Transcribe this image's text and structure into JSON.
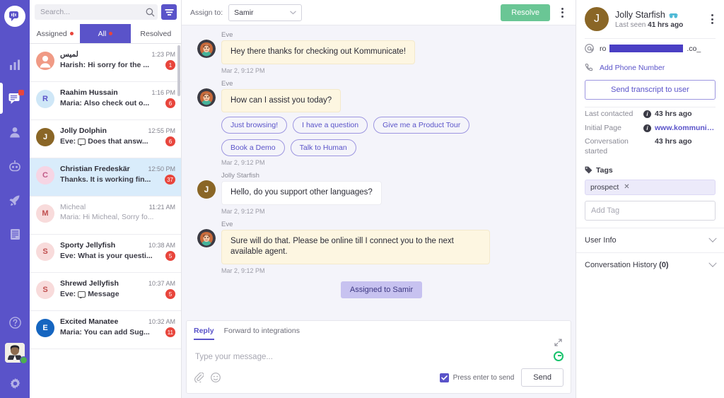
{
  "rail": {
    "logo_icon": "kommunicate-logo-icon",
    "items": [
      {
        "icon": "bar-chart-icon",
        "name": "dashboard"
      },
      {
        "icon": "chat-icon",
        "name": "conversations",
        "active": true,
        "badge": true
      },
      {
        "icon": "people-icon",
        "name": "users"
      },
      {
        "icon": "bot-icon",
        "name": "bots"
      },
      {
        "icon": "rocket-icon",
        "name": "integrations"
      },
      {
        "icon": "book-icon",
        "name": "knowledge-base"
      }
    ],
    "bottom": [
      {
        "icon": "help-icon",
        "name": "help"
      },
      {
        "icon": "avatar",
        "name": "account",
        "status": "online"
      },
      {
        "icon": "gear-icon",
        "name": "settings"
      }
    ]
  },
  "search": {
    "placeholder": "Search...",
    "value": "",
    "filter_icon": "filter-icon",
    "search_icon": "search-icon"
  },
  "tabs": [
    {
      "label": "Assigned",
      "dot": true,
      "active": false
    },
    {
      "label": "All",
      "dot": true,
      "active": true
    },
    {
      "label": "Resolved",
      "dot": false,
      "active": false
    }
  ],
  "conversations": [
    {
      "initial": "",
      "name": "لميس",
      "preview": "Harish: Hi sorry for the ...",
      "time": "1:23 PM",
      "badge": "1",
      "avatar_bg": "#f09a85",
      "avatar_fg": "#ffffff",
      "selected": false,
      "read": false,
      "photo": true
    },
    {
      "initial": "R",
      "name": "Raahim Hussain",
      "preview": "Maria: Also check out o...",
      "time": "1:16 PM",
      "badge": "6",
      "avatar_bg": "#cfe7f7",
      "avatar_fg": "#5a53c9",
      "selected": false,
      "read": false
    },
    {
      "initial": "J",
      "name": "Jolly Dolphin",
      "preview": "Eve: 💬 Does that answ...",
      "preview_text": "Does that answ...",
      "preview_prefix": "Eve:",
      "msgicon": true,
      "time": "12:55 PM",
      "badge": "6",
      "avatar_bg": "#8a6626",
      "avatar_fg": "#ffffff",
      "selected": false,
      "read": false
    },
    {
      "initial": "C",
      "name": "Christian Fredeskär",
      "preview": "Thanks. It is working fin...",
      "time": "12:50 PM",
      "badge": "37",
      "avatar_bg": "#f6d5e4",
      "avatar_fg": "#c05b88",
      "selected": true,
      "read": false
    },
    {
      "initial": "M",
      "name": "Micheal",
      "preview": "Maria: Hi Micheal, Sorry fo...",
      "time": "11:21 AM",
      "badge": "",
      "avatar_bg": "#f8dbdb",
      "avatar_fg": "#c05050",
      "selected": false,
      "read": true
    },
    {
      "initial": "S",
      "name": "Sporty Jellyfish",
      "preview": "Eve: What is your questi...",
      "time": "10:38 AM",
      "badge": "5",
      "avatar_bg": "#f8dbdb",
      "avatar_fg": "#c05050",
      "selected": false,
      "read": false
    },
    {
      "initial": "S",
      "name": "Shrewd Jellyfish",
      "preview_prefix": "Eve:",
      "preview_text": "Message",
      "msgicon": true,
      "preview": "Eve: 💬 Message",
      "time": "10:37 AM",
      "badge": "5",
      "avatar_bg": "#f8dbdb",
      "avatar_fg": "#c05050",
      "selected": false,
      "read": false
    },
    {
      "initial": "E",
      "name": "Excited Manatee",
      "preview": "Maria: You can add Sug...",
      "time": "10:32 AM",
      "badge": "11",
      "avatar_bg": "#1565c0",
      "avatar_fg": "#ffffff",
      "selected": false,
      "read": false
    }
  ],
  "chat_header": {
    "assign_label": "Assign to:",
    "assignee": "Samir",
    "resolve_label": "Resolve",
    "kebab_icon": "more-vertical-icon"
  },
  "messages": [
    {
      "type": "bot",
      "sender": "Eve",
      "text": "Hey there thanks for checking out Kommunicate!",
      "timestamp": "Mar 2, 9:12 PM"
    },
    {
      "type": "bot",
      "sender": "Eve",
      "text": "How can I assist you today?",
      "timestamp": "Mar 2, 9:12 PM",
      "quick_replies": [
        "Just browsing!",
        "I have a question",
        "Give me a Product Tour",
        "Book a Demo",
        "Talk to Human"
      ]
    },
    {
      "type": "user",
      "sender": "Jolly Starfish",
      "text": "Hello, do you support other languages?",
      "timestamp": "Mar 2, 9:12 PM"
    },
    {
      "type": "bot",
      "sender": "Eve",
      "text": "Sure will do that. Please be online till I connect you to the next available agent.",
      "timestamp": "Mar 2, 9:12 PM"
    }
  ],
  "system_note": "Assigned to Samir",
  "composer": {
    "tabs": [
      {
        "label": "Reply",
        "active": true
      },
      {
        "label": "Forward to integrations",
        "active": false
      }
    ],
    "placeholder": "Type your message...",
    "value": "",
    "attach_icon": "paperclip-icon",
    "emoji_icon": "emoji-icon",
    "expand_icon": "expand-icon",
    "grammarly_icon": "grammarly-icon",
    "checkbox_label": "Press enter to send",
    "checkbox_checked": true,
    "send_label": "Send"
  },
  "right_panel": {
    "name": "Jolly Starfish",
    "name_icon": "incognito-icon",
    "last_seen_prefix": "Last seen",
    "last_seen": "41 hrs ago",
    "kebab_icon": "more-vertical-icon",
    "email_icon": "at-icon",
    "email_prefix": "ro",
    "email_suffix": ".co_",
    "phone_icon": "phone-icon",
    "add_phone_label": "Add Phone Number",
    "transcript_label": "Send transcript to user",
    "meta": [
      {
        "key": "Last contacted",
        "info": true,
        "value": "43 hrs ago",
        "link": false
      },
      {
        "key": "Initial Page",
        "info": true,
        "value": "www.kommunicate.i...",
        "link": true
      },
      {
        "key": "Conversation started",
        "info": false,
        "value": "43 hrs ago",
        "link": false
      }
    ],
    "tags_icon": "tag-icon",
    "tags_label": "Tags",
    "tags": [
      "prospect"
    ],
    "add_tag_placeholder": "Add Tag",
    "accordions": [
      {
        "label": "User Info",
        "count": ""
      },
      {
        "label": "Conversation History",
        "count": "(0)"
      }
    ]
  },
  "colors": {
    "brand_purple": "#5a53c9",
    "resolve_green": "#6ac695",
    "badge_red": "#e8453c",
    "selected_blue": "#d9ecfb",
    "bot_bubble": "#fdf6e1",
    "system_pill": "#c7c2f0"
  }
}
